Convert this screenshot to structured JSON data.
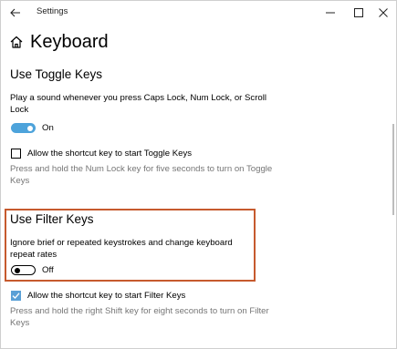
{
  "window": {
    "title": "Settings",
    "back_icon": "back-arrow-icon",
    "controls": [
      "minimize-icon",
      "maximize-icon",
      "close-icon"
    ]
  },
  "header": {
    "icon": "home-icon",
    "title": "Keyboard"
  },
  "toggle_keys": {
    "title": "Use Toggle Keys",
    "description": "Play a sound whenever you press Caps Lock, Num Lock, or Scroll Lock",
    "toggle_state": "On",
    "toggle_on": true,
    "shortcut_label": "Allow the shortcut key to start Toggle Keys",
    "shortcut_checked": false,
    "shortcut_hint": "Press and hold the Num Lock key for five seconds to turn on Toggle Keys"
  },
  "filter_keys": {
    "title": "Use Filter Keys",
    "description": "Ignore brief or repeated keystrokes and change keyboard repeat rates",
    "toggle_state": "Off",
    "toggle_on": false,
    "shortcut_label": "Allow the shortcut key to start Filter Keys",
    "shortcut_checked": true,
    "shortcut_hint": "Press and hold the right Shift key for eight seconds to turn on Filter Keys"
  },
  "colors": {
    "accent": "#4da3db",
    "highlight": "#c65a2e",
    "hint_text": "#767676"
  }
}
